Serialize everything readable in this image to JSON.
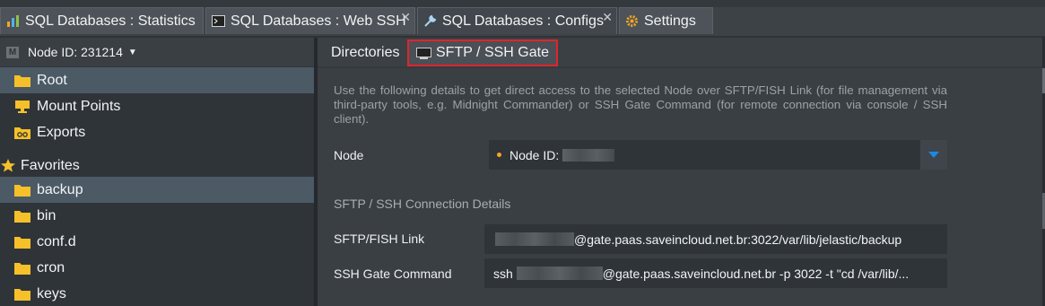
{
  "tabs": [
    {
      "label": "SQL Databases : Statistics",
      "icon": "chart-icon"
    },
    {
      "label": "SQL Databases : Web SSH",
      "icon": "terminal-icon"
    },
    {
      "label": "SQL Databases : Configs",
      "icon": "wrench-icon"
    },
    {
      "label": "Settings",
      "icon": "gear-icon"
    }
  ],
  "sidebar": {
    "node_label": "Node ID: 231214",
    "items": [
      {
        "label": "Root",
        "icon": "folder-icon"
      },
      {
        "label": "Mount Points",
        "icon": "mount-icon"
      },
      {
        "label": "Exports",
        "icon": "exports-icon"
      },
      {
        "label": "Favorites",
        "icon": "star-icon"
      },
      {
        "label": "backup",
        "icon": "folder-icon"
      },
      {
        "label": "bin",
        "icon": "folder-icon"
      },
      {
        "label": "conf.d",
        "icon": "folder-icon"
      },
      {
        "label": "cron",
        "icon": "folder-icon"
      },
      {
        "label": "keys",
        "icon": "folder-icon"
      }
    ]
  },
  "main": {
    "subtabs": [
      {
        "label": "Directories"
      },
      {
        "label": "SFTP / SSH Gate",
        "icon": "terminal-icon"
      }
    ],
    "description": "Use the following details to get direct access to the selected Node over SFTP/FISH Link (for file management via third-party tools, e.g. Midnight Commander) or SSH Gate Command (for remote connection via console / SSH client).",
    "node_field": {
      "label": "Node",
      "value": "Node ID:"
    },
    "section_title": "SFTP / SSH Connection Details",
    "sftp": {
      "label": "SFTP/FISH Link",
      "value": "@gate.paas.saveincloud.net.br:3022/var/lib/jelastic/backup"
    },
    "ssh": {
      "label": "SSH Gate Command",
      "prefix": "ssh",
      "value": "@gate.paas.saveincloud.net.br -p 3022 -t \"cd /var/lib/..."
    }
  },
  "colors": {
    "accent": "#e0252b",
    "folder": "#f5c02a",
    "dropdown": "#1e88e5",
    "status_dot": "#f5a623"
  }
}
